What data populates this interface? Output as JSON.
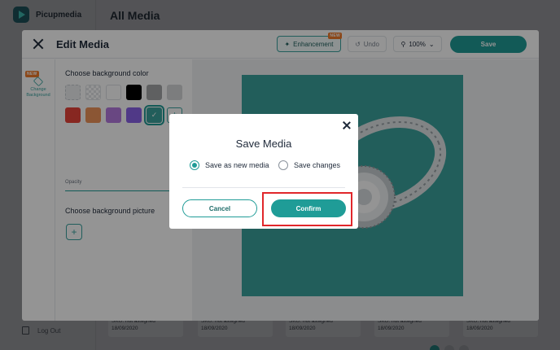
{
  "app": {
    "name": "Picupmedia",
    "page_title": "All Media",
    "logout_label": "Log Out"
  },
  "bg_cards": [
    {
      "sku": "SKU: not assigned",
      "date": "18/09/2020"
    },
    {
      "sku": "SKU: not assigned",
      "date": "18/09/2020"
    },
    {
      "sku": "SKU: not assigned",
      "date": "18/09/2020"
    },
    {
      "sku": "SKU: not assigned",
      "date": "18/09/2020"
    },
    {
      "sku": "SKU: not assigned",
      "date": "18/09/2020"
    }
  ],
  "editor": {
    "title": "Edit Media",
    "enhancement_label": "Enhancement",
    "new_badge": "NEW",
    "undo_label": "Undo",
    "zoom_value": "100%",
    "save_label": "Save",
    "tool_label": "Change Background"
  },
  "options": {
    "bg_color_heading": "Choose background color",
    "opacity_label": "Opacity",
    "bg_picture_heading": "Choose background picture",
    "swatches_row1": [
      "transparent-grid",
      "checker",
      "#ffffff",
      "#000000",
      "#a4a6a8",
      "#d6d8da"
    ],
    "swatches_row2": [
      "#e8443a",
      "#f0955a",
      "#b57be0",
      "#8a63e8",
      "#3ba39d"
    ]
  },
  "modal": {
    "title": "Save Media",
    "option_new": "Save as new media",
    "option_changes": "Save changes",
    "selected": "new",
    "cancel_label": "Cancel",
    "confirm_label": "Confirm"
  },
  "colors": {
    "accent": "#1f9c97",
    "photo_bg": "#3ba39d",
    "highlight": "#e0262b"
  }
}
